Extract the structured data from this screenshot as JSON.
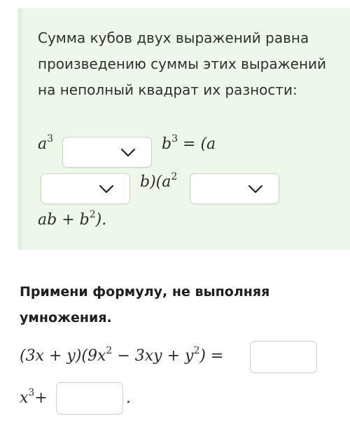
{
  "theory": {
    "text": "Сумма кубов двух выражений равна произведению суммы этих выражений на неполный квадрат их разности:",
    "formula": {
      "a": "a",
      "exp3": "3",
      "b": "b",
      "eq_open": "= (a",
      "b_close": "b)(a",
      "exp2": "2",
      "tail_ab": "ab + b",
      "tail_end": ")."
    }
  },
  "dropdowns": {
    "op1": {
      "selected": ""
    },
    "op2": {
      "selected": ""
    },
    "op3": {
      "selected": ""
    }
  },
  "task": {
    "title": "Примени формулу, не выполняя умножения.",
    "expr": {
      "left": "(3x + y)(9x",
      "exp2a": "2",
      "middle": " − 3xy + y",
      "exp2b": "2",
      "right": ") =",
      "x": "x",
      "exp3": "3",
      "plus": "+",
      "dot": "."
    },
    "answer1": "",
    "answer2": ""
  },
  "icons": {
    "chevron": "chevron-down-icon"
  },
  "colors": {
    "panel": "#eef8ea",
    "panel_border": "#e2f1dc",
    "box_border": "#cfcfcf"
  }
}
